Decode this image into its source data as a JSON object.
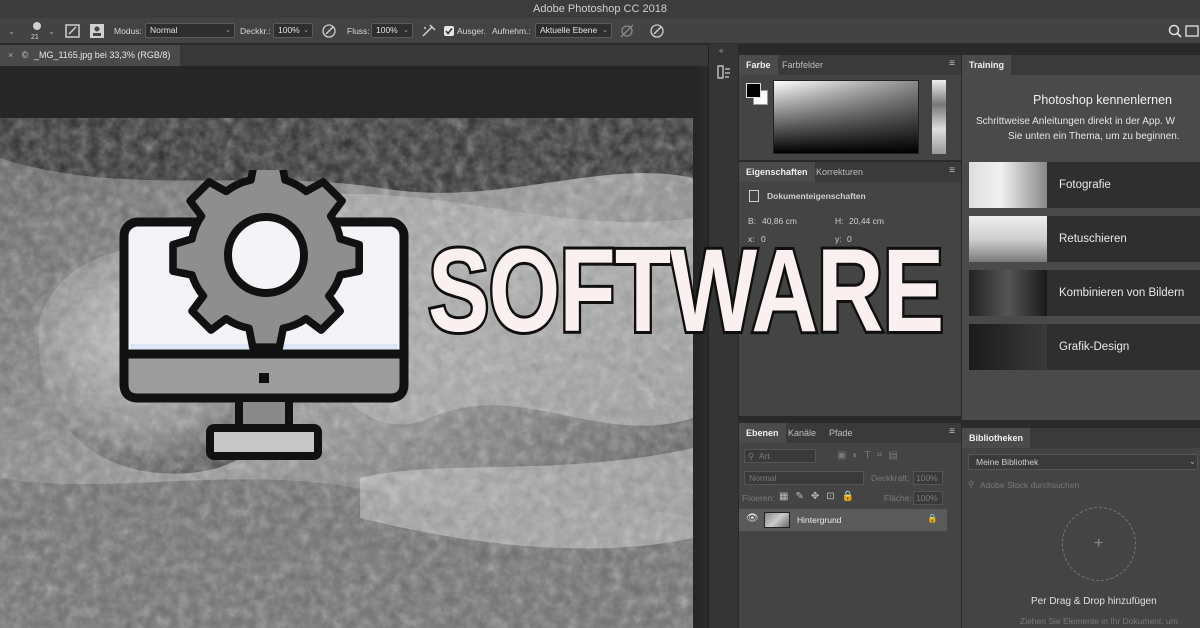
{
  "app": {
    "title": "Adobe Photoshop CC 2018"
  },
  "options": {
    "brush_size": "21",
    "modus_label": "Modus:",
    "modus_value": "Normal",
    "deckkr_label": "Deckkr.:",
    "deckkr_value": "100%",
    "fluss_label": "Fluss:",
    "fluss_value": "100%",
    "ausger_label": "Ausger.",
    "aufnehm_label": "Aufnehm.:",
    "aufnehm_value": "Aktuelle Ebene"
  },
  "document": {
    "tab_title": "_MG_1165.jpg bei 33,3% (RGB/8)"
  },
  "color_panel": {
    "tabs": [
      "Farbe",
      "Farbfelder"
    ]
  },
  "properties_panel": {
    "tabs": [
      "Eigenschaften",
      "Korrekturen"
    ],
    "section": "Dokumenteigenschaften",
    "b_label": "B:",
    "b_value": "40,86 cm",
    "h_label": "H:",
    "h_value": "20,44 cm",
    "x_label": "x:",
    "x_value": "0",
    "y_label": "y:",
    "y_value": "0"
  },
  "layers_panel": {
    "tabs": [
      "Ebenen",
      "Kanäle",
      "Pfade"
    ],
    "filter_placeholder": "Art",
    "blend_mode": "Normal",
    "opacity_label": "Deckkraft:",
    "opacity_value": "100%",
    "lock_label": "Fixieren:",
    "fill_label": "Fläche:",
    "fill_value": "100%",
    "layer_name": "Hintergrund"
  },
  "training_panel": {
    "tab": "Training",
    "heading": "Photoshop kennenlernen",
    "subtext_line1": "Schrittweise Anleitungen direkt in der App. W",
    "subtext_line2": "Sie unten ein Thema, um zu beginnen.",
    "items": [
      "Fotografie",
      "Retuschieren",
      "Kombinieren von Bildern",
      "Grafik-Design"
    ]
  },
  "libraries_panel": {
    "tab": "Bibliotheken",
    "library": "Meine Bibliothek",
    "search_placeholder": "Adobe Stock durchsuchen",
    "drop_title": "Per Drag & Drop hinzufügen",
    "drop_text": "Ziehen Sie Elemente in Ihr Dokument, um"
  },
  "overlay": {
    "headline": "SOFTWARE",
    "icon": "monitor-gear-icon"
  }
}
